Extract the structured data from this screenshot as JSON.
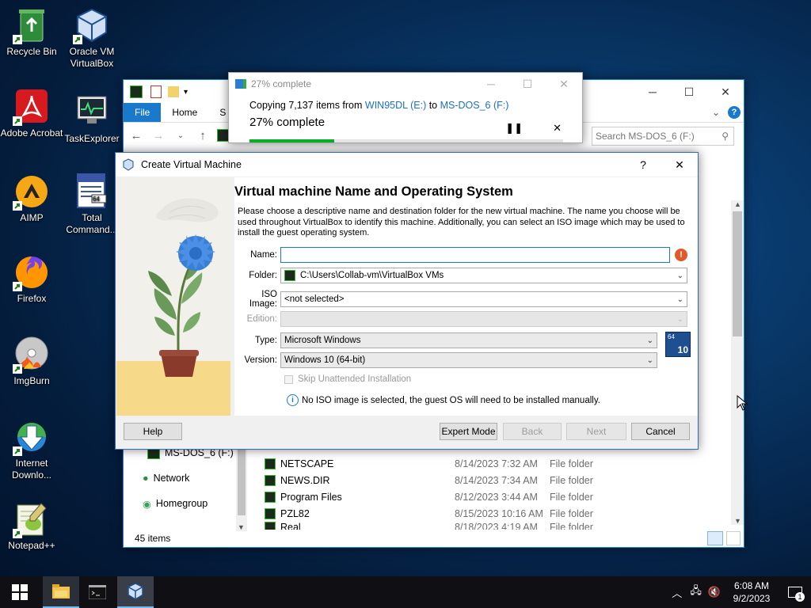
{
  "desktop": {
    "icons": [
      {
        "label": "Recycle Bin",
        "icon": "recycle-bin-icon"
      },
      {
        "label": "Oracle VM VirtualBox",
        "icon": "virtualbox-icon"
      },
      {
        "label": "Adobe Acrobat",
        "icon": "acrobat-icon"
      },
      {
        "label": "TaskExplorer",
        "icon": "task-explorer-icon"
      },
      {
        "label": "AIMP",
        "icon": "aimp-icon"
      },
      {
        "label": "Total Command...",
        "icon": "total-commander-icon"
      },
      {
        "label": "Firefox",
        "icon": "firefox-icon"
      },
      {
        "label": "ImgBurn",
        "icon": "imgburn-icon"
      },
      {
        "label": "Internet Downlo...",
        "icon": "idm-icon"
      },
      {
        "label": "Notepad++",
        "icon": "notepadpp-icon"
      }
    ]
  },
  "explorer": {
    "ribbon_tabs": [
      "File",
      "Home",
      "S"
    ],
    "search_placeholder": "Search MS-DOS_6 (F:)",
    "nav": {
      "drive": "MS-DOS_6 (F:)",
      "network": "Network",
      "homegroup": "Homegroup"
    },
    "files": [
      {
        "name": "NETSCAPE",
        "date": "8/14/2023 7:32 AM",
        "type": "File folder"
      },
      {
        "name": "NEWS.DIR",
        "date": "8/14/2023 7:34 AM",
        "type": "File folder"
      },
      {
        "name": "Program Files",
        "date": "8/12/2023 3:44 AM",
        "type": "File folder"
      },
      {
        "name": "PZL82",
        "date": "8/15/2023 10:16 AM",
        "type": "File folder"
      },
      {
        "name": "Real",
        "date": "8/18/2023 4:19 AM",
        "type": "File folder"
      }
    ],
    "status": "45 items"
  },
  "copy_dialog": {
    "title": "27% complete",
    "line_prefix": "Copying 7,137 items from ",
    "source": "WIN95DL (E:)",
    "line_mid": " to ",
    "dest": "MS-DOS_6 (F:)",
    "progress_text": "27% complete",
    "progress": 0.27
  },
  "vm_dialog": {
    "title": "Create Virtual Machine",
    "heading": "Virtual machine Name and Operating System",
    "description": "Please choose a descriptive name and destination folder for the new virtual machine. The name you choose will be used throughout VirtualBox to identify this machine. Additionally, you can select an ISO image which may be used to install the guest operating system.",
    "fields": {
      "name_label": "Name:",
      "name_value": "",
      "folder_label": "Folder:",
      "folder_value": "C:\\Users\\Collab-vm\\VirtualBox VMs",
      "iso_label": "ISO Image:",
      "iso_value": "<not selected>",
      "edition_label": "Edition:",
      "edition_value": "",
      "type_label": "Type:",
      "type_value": "Microsoft Windows",
      "version_label": "Version:",
      "version_value": "Windows 10 (64-bit)"
    },
    "skip_unattended": "Skip Unattended Installation",
    "info": "No ISO image is selected, the guest OS will need to be installed manually.",
    "os_badge": {
      "top": "64",
      "bottom": "10"
    },
    "buttons": {
      "help": "Help",
      "expert": "Expert Mode",
      "back": "Back",
      "next": "Next",
      "cancel": "Cancel"
    }
  },
  "taskbar": {
    "time": "6:08 AM",
    "date": "9/2/2023",
    "notification_count": "1"
  }
}
